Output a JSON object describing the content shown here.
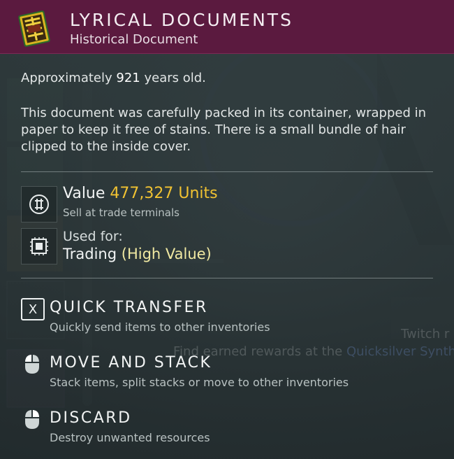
{
  "header": {
    "title": "LYRICAL DOCUMENTS",
    "subtitle": "Historical Document",
    "icon": "document-book-icon"
  },
  "info": {
    "age_prefix": "Approximately",
    "age_value": "921",
    "age_suffix": "years old.",
    "description": "This document was carefully packed in its container, wrapped in paper to keep it free of stains. There is a small bundle of hair clipped to the inside cover."
  },
  "value": {
    "label": "Value",
    "amount": "477,327 Units",
    "note": "Sell at trade terminals",
    "icon": "units-currency-icon"
  },
  "usage": {
    "label": "Used for:",
    "use": "Trading",
    "qualifier": "(High Value)",
    "icon": "trade-chip-icon"
  },
  "actions": [
    {
      "key": "X",
      "title": "QUICK TRANSFER",
      "subtitle": "Quickly send items to other inventories",
      "icon": "x-key-icon"
    },
    {
      "title": "MOVE AND STACK",
      "subtitle": "Stack items, split stacks or move to other inventories",
      "icon": "mouse-left-click-icon"
    },
    {
      "title": "DISCARD",
      "subtitle": "Destroy unwanted resources",
      "icon": "mouse-right-click-icon"
    }
  ],
  "background_text": {
    "twitch": "Twitch r",
    "rewards_prefix": "Find earned rewards at the",
    "rewards_place": "Quicksilver Synth"
  },
  "colors": {
    "header_bg": "#5b1a3f",
    "value_accent": "#f1c232",
    "high_value_accent": "#f1e9a2"
  }
}
